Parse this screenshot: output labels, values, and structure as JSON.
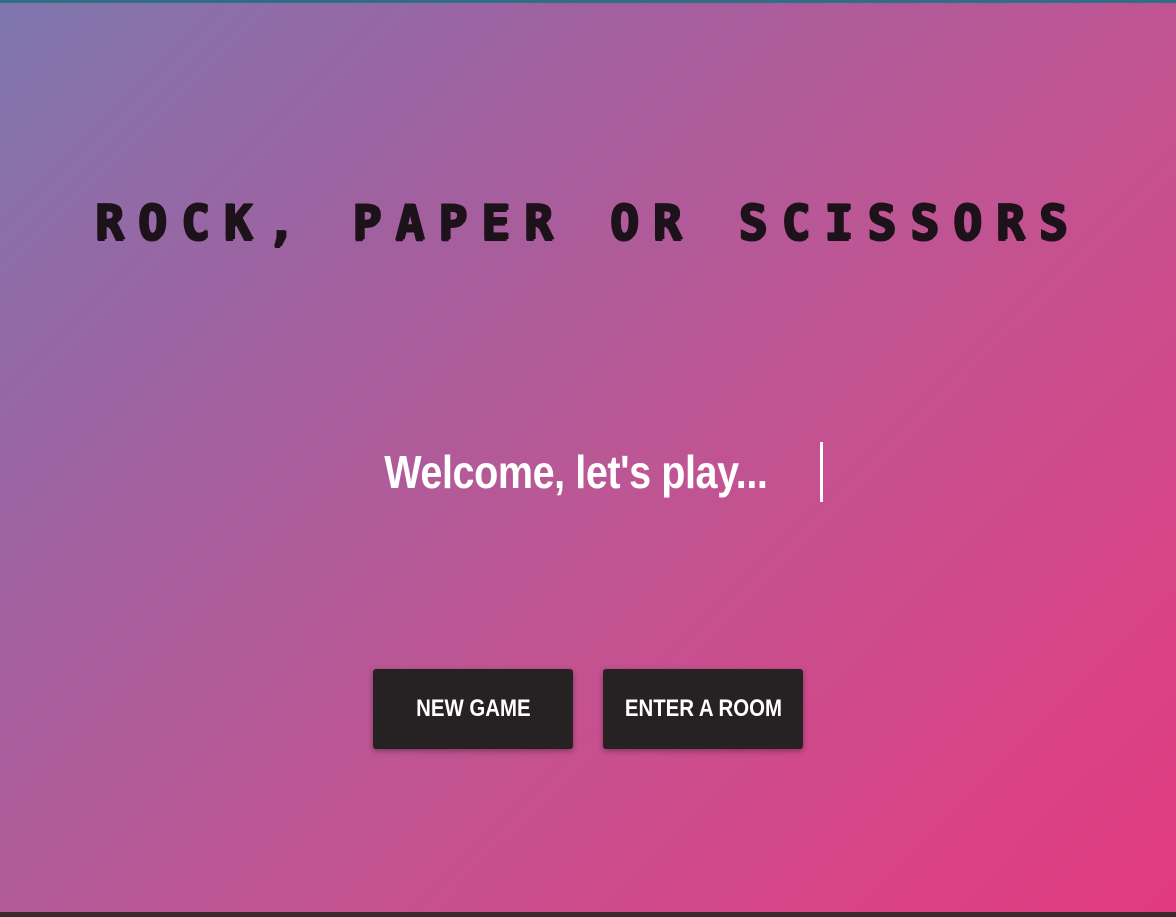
{
  "game": {
    "title": "ROCK, PAPER OR SCISSORS",
    "welcome": "Welcome, let's play...",
    "buttons": {
      "new_game": "NEW GAME",
      "enter_room": "ENTER A ROOM"
    }
  },
  "colors": {
    "gradient_start": "#7e77ae",
    "gradient_end": "#e23a80",
    "button_bg": "#262224",
    "title_text": "#1e121a",
    "welcome_text": "#ffffff"
  }
}
